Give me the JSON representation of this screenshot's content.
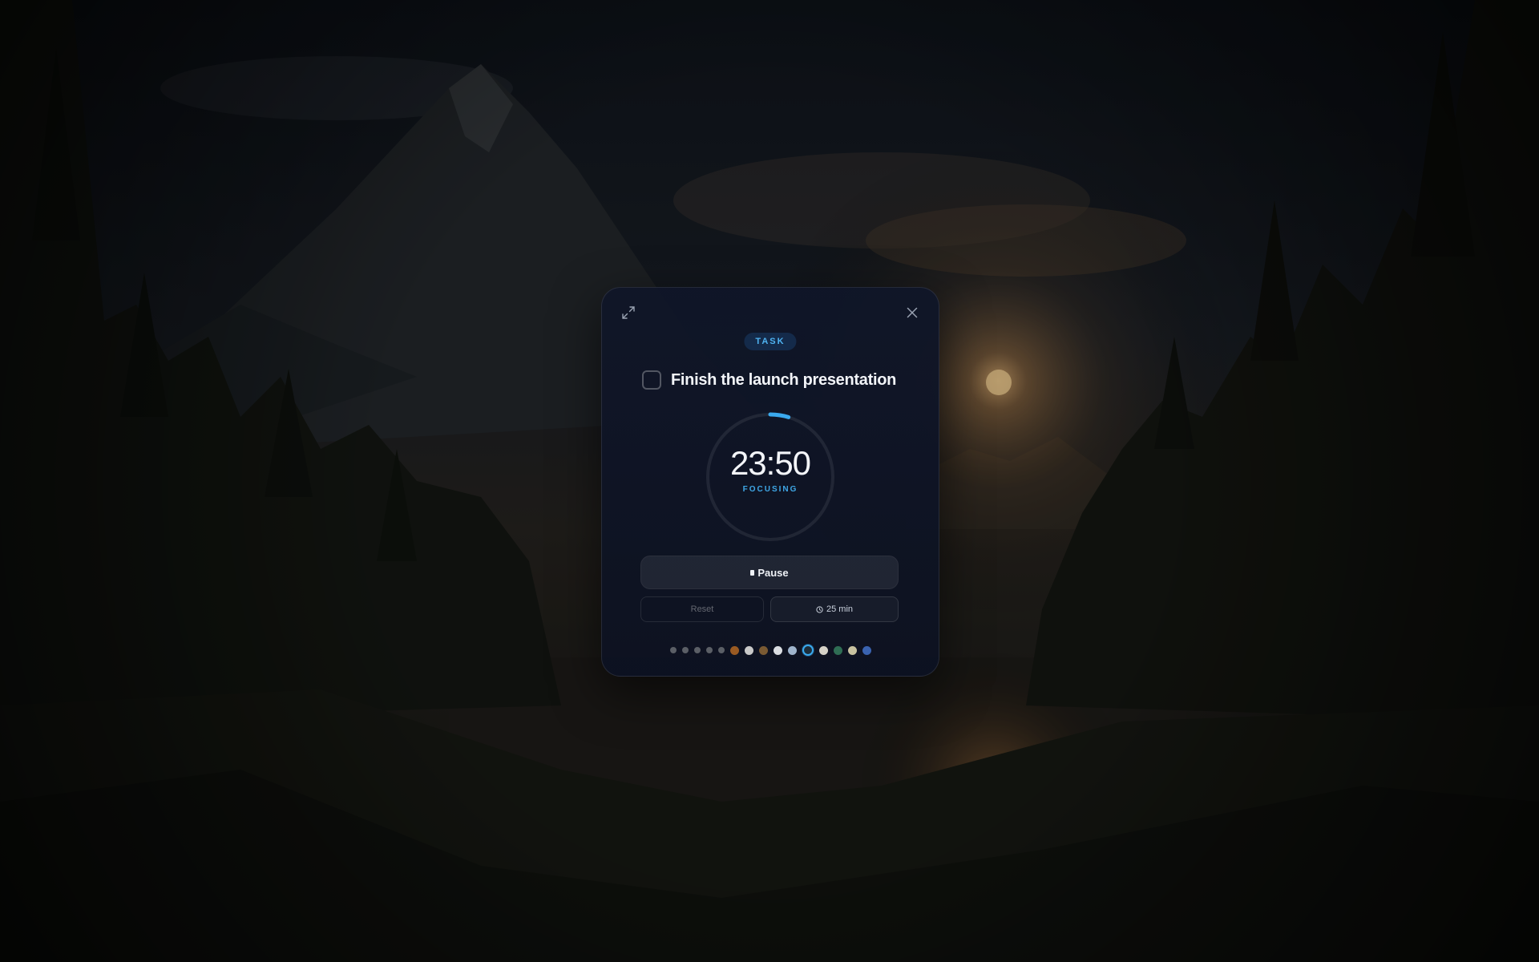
{
  "card": {
    "badge": "TASK",
    "task_title": "Finish the launch presentation",
    "task_done": false
  },
  "timer": {
    "time": "23:50",
    "status": "FOCUSING",
    "progress_fraction": 0.047,
    "accent_color": "#3aa9ee"
  },
  "controls": {
    "pause_label": "Pause",
    "reset_label": "Reset",
    "duration_label": "25 min"
  },
  "themes": {
    "selected_index": 10,
    "swatches": [
      {
        "name": "gray-1",
        "color": "#5b5f66"
      },
      {
        "name": "gray-2",
        "color": "#5b5f66"
      },
      {
        "name": "gray-3",
        "color": "#5b5f66"
      },
      {
        "name": "gray-4",
        "color": "#5b5f66"
      },
      {
        "name": "gray-5",
        "color": "#5b5f66"
      },
      {
        "name": "amber-landscape",
        "color": "#9a5a22"
      },
      {
        "name": "light-clouds",
        "color": "#c9c9c9"
      },
      {
        "name": "dusk-forest",
        "color": "#7a5a33"
      },
      {
        "name": "pale-sky",
        "color": "#dadde2"
      },
      {
        "name": "blue-light",
        "color": "#9fb4cc"
      },
      {
        "name": "night-mountain",
        "color": "#1c2d3a"
      },
      {
        "name": "mist",
        "color": "#d6d2c8"
      },
      {
        "name": "green-forest",
        "color": "#2f6d54"
      },
      {
        "name": "sand-meadow",
        "color": "#c8c2a0"
      },
      {
        "name": "ocean-blue",
        "color": "#3a63b0"
      }
    ]
  },
  "icons": {
    "expand": "expand-icon",
    "close": "close-icon",
    "duration": "clock-icon",
    "pause": "pause-icon"
  }
}
